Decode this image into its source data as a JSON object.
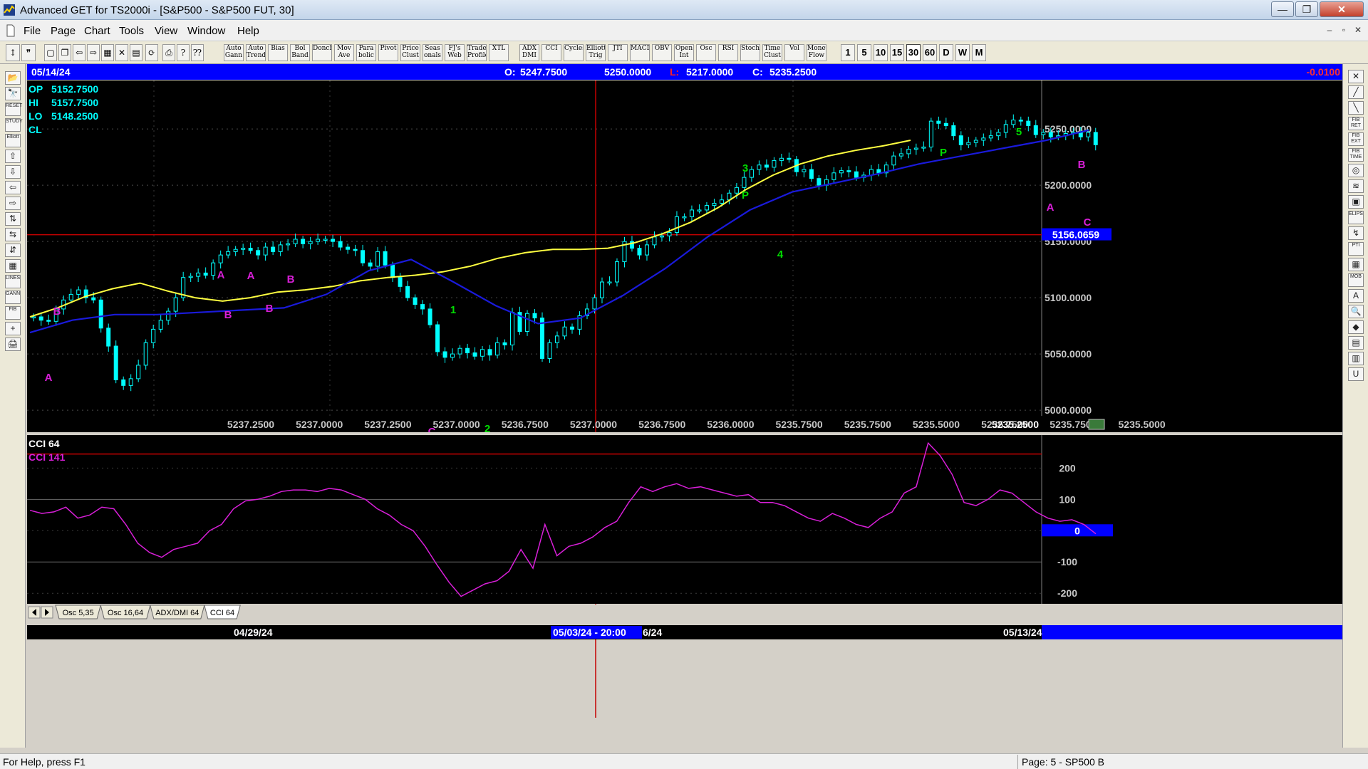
{
  "window": {
    "title": "Advanced GET for TS2000i - [S&P500 - S&P500 FUT, 30]",
    "min_glyph": "—",
    "max_glyph": "❐",
    "close_glyph": "✕"
  },
  "menu": {
    "items": [
      "File",
      "Page",
      "Chart",
      "Tools",
      "View",
      "Window",
      "Help"
    ],
    "mdi": [
      "–",
      "▫",
      "✕"
    ]
  },
  "toolbar": {
    "studies": [
      "Auto Gann",
      "Auto Trend",
      "Bias",
      "Bol Band",
      "Donch",
      "Mov Ave",
      "Para bolic",
      "Pivot",
      "Price Clust",
      "Seas onals",
      "FJ's Web",
      "Trade Profile",
      "XTL",
      "ADX DMI",
      "CCI",
      "Cycles",
      "Elliott Trig",
      "JTI",
      "MACD",
      "OBV",
      "Open Int",
      "Osc",
      "RSI",
      "Stoch",
      "Time Clust",
      "Vol",
      "Money Flow"
    ],
    "timeframes": [
      "1",
      "5",
      "10",
      "15",
      "30",
      "60",
      "D",
      "W",
      "M"
    ],
    "active_timeframe": "30"
  },
  "left_tools": [
    "📂",
    "🔭",
    "RESET",
    "STUDY",
    "Elliott",
    "⇧",
    "⇩",
    "⇦",
    "⇨",
    "⇅",
    "⇆",
    "⇵",
    "▦",
    "LINES",
    "GANN",
    "FIB",
    "+",
    "🖨"
  ],
  "right_tools": [
    "✕",
    "╱",
    "╲",
    "FIB RET",
    "FIB EXT",
    "FIB TIME",
    "◎",
    "≋",
    "▣",
    "ELIPS",
    "↯",
    "PTI",
    "▦",
    "MOB",
    "A",
    "🔍",
    "◆",
    "▤",
    "▥",
    "U"
  ],
  "infobar": {
    "date": "05/14/24",
    "open_label": "O:",
    "open": "5247.7500",
    "high": "5250.0000",
    "low_label": "L:",
    "low": "5217.0000",
    "close_label": "C:",
    "close": "5235.2500",
    "change": "-0.0100"
  },
  "ohlc_panel": [
    {
      "label": "OP",
      "value": "5152.7500"
    },
    {
      "label": "HI",
      "value": "5157.7500"
    },
    {
      "label": "LO",
      "value": "5148.2500"
    },
    {
      "label": "CL",
      "value": ""
    }
  ],
  "price_axis": {
    "ticks": [
      "5250.0000",
      "5200.0000",
      "5150.0000",
      "5100.0000",
      "5050.0000",
      "5000.0000"
    ],
    "tick_values": [
      5250,
      5200,
      5150,
      5100,
      5050,
      5000
    ],
    "cursor_price": "5156.0659",
    "cursor_value": 5156.0659,
    "range": [
      4995,
      5290
    ]
  },
  "bottom_values": [
    "5237.2500",
    "5237.0000",
    "5237.2500",
    "5237.0000",
    "5236.7500",
    "5237.0000",
    "5236.7500",
    "5236.0000",
    "5235.7500",
    "5235.7500",
    "5235.5000",
    "5235.7500",
    "5235.7500",
    "5235.5000"
  ],
  "last_value": "5235.2500",
  "cci": {
    "labels": [
      "CCI 64",
      "CCI  141"
    ],
    "ticks": [
      "200",
      "100",
      "-100",
      "-200"
    ],
    "tick_values": [
      200,
      100,
      -100,
      -200
    ],
    "zero_label": "0",
    "range": [
      -220,
      285
    ],
    "upper_line": 245
  },
  "tabs": [
    "Osc 5,35",
    "Osc 16,64",
    "ADX/DMI 64",
    "CCI 64"
  ],
  "active_tab": "CCI 64",
  "date_bar": {
    "dates": [
      "04/29/24",
      "05/13/24"
    ],
    "cursor_date": "05/03/24 - 20:00",
    "partial_date": "6/24"
  },
  "statusbar": {
    "help": "For Help, press F1",
    "page": "Page: 5 - SP500 B"
  },
  "colors": {
    "background": "#000000",
    "price_up": "#00ffff",
    "ma_fast": "#ffff40",
    "ma_slow": "#1a1adb",
    "cci": "#d81fd8",
    "elliott_green": "#00dd00",
    "elliott_magenta": "#d81fd8",
    "infobar": "#0000ff",
    "crosshair": "#c40000"
  },
  "chart_data": {
    "type": "candlestick",
    "price_series": [
      5083,
      5080,
      5079,
      5090,
      5098,
      5103,
      5107,
      5100,
      5098,
      5073,
      5057,
      5027,
      5022,
      5028,
      5040,
      5060,
      5072,
      5080,
      5088,
      5100,
      5118,
      5119,
      5122,
      5120,
      5131,
      5138,
      5141,
      5143,
      5144,
      5142,
      5138,
      5145,
      5141,
      5147,
      5148,
      5152,
      5148,
      5150,
      5152,
      5152,
      5150,
      5145,
      5143,
      5142,
      5131,
      5128,
      5141,
      5129,
      5118,
      5110,
      5100,
      5094,
      5090,
      5076,
      5052,
      5047,
      5050,
      5055,
      5051,
      5048,
      5054,
      5049,
      5060,
      5058,
      5087,
      5070,
      5086,
      5082,
      5046,
      5060,
      5066,
      5074,
      5072,
      5084,
      5090,
      5100,
      5114,
      5114,
      5132,
      5150,
      5144,
      5138,
      5147,
      5154,
      5155,
      5158,
      5172,
      5172,
      5178,
      5178,
      5182,
      5184,
      5187,
      5193,
      5198,
      5207,
      5214,
      5218,
      5216,
      5222,
      5224,
      5223,
      5212,
      5214,
      5206,
      5200,
      5205,
      5211,
      5213,
      5212,
      5207,
      5209,
      5214,
      5211,
      5218,
      5226,
      5228,
      5232,
      5233,
      5234,
      5257,
      5255,
      5253,
      5244,
      5236,
      5238,
      5240,
      5242,
      5244,
      5247,
      5254,
      5258,
      5257,
      5253,
      5245,
      5247,
      5243,
      5244,
      5246,
      5247,
      5243,
      5247,
      5236
    ],
    "ma_fast_series": [
      5083,
      5091,
      5101,
      5108,
      5113,
      5106,
      5100,
      5097,
      5100,
      5105,
      5107,
      5110,
      5115,
      5118,
      5120,
      5123,
      5128,
      5135,
      5140,
      5143,
      5143,
      5144,
      5149,
      5157,
      5167,
      5180,
      5196,
      5209,
      5219,
      5226,
      5231,
      5235,
      5240
    ],
    "ma_slow_series": [
      5069,
      5080,
      5085,
      5085,
      5087,
      5089,
      5091,
      5103,
      5124,
      5134,
      5114,
      5093,
      5077,
      5082,
      5102,
      5126,
      5154,
      5178,
      5194,
      5202,
      5210,
      5219,
      5226,
      5233,
      5240,
      5249
    ],
    "elliott_labels": [
      {
        "text": "A",
        "color": "magenta"
      },
      {
        "text": "B",
        "color": "magenta"
      },
      {
        "text": "P",
        "color": "green"
      },
      {
        "text": "C",
        "color": "magenta"
      },
      {
        "text": "B",
        "color": "magenta"
      },
      {
        "text": "A",
        "color": "magenta"
      },
      {
        "text": "B",
        "color": "magenta"
      },
      {
        "text": "A",
        "color": "magenta"
      },
      {
        "text": "B",
        "color": "magenta"
      },
      {
        "text": "1",
        "color": "green"
      },
      {
        "text": "C",
        "color": "magenta"
      },
      {
        "text": "2",
        "color": "green"
      },
      {
        "text": "3",
        "color": "green"
      },
      {
        "text": "P",
        "color": "green"
      },
      {
        "text": "4",
        "color": "green"
      },
      {
        "text": "5",
        "color": "green"
      },
      {
        "text": "P",
        "color": "green"
      },
      {
        "text": "B",
        "color": "magenta"
      },
      {
        "text": "A",
        "color": "magenta"
      },
      {
        "text": "C",
        "color": "magenta"
      }
    ],
    "cci_series": [
      65,
      55,
      60,
      75,
      40,
      50,
      75,
      70,
      20,
      -40,
      -70,
      -85,
      -60,
      -50,
      -40,
      0,
      20,
      70,
      95,
      100,
      110,
      125,
      130,
      130,
      125,
      135,
      130,
      115,
      100,
      70,
      50,
      20,
      0,
      -50,
      -110,
      -165,
      -210,
      -190,
      -170,
      -160,
      -130,
      -60,
      -120,
      20,
      -80,
      -50,
      -40,
      -20,
      10,
      30,
      90,
      140,
      125,
      140,
      150,
      135,
      140,
      130,
      120,
      110,
      115,
      90,
      90,
      80,
      60,
      40,
      30,
      55,
      40,
      20,
      10,
      40,
      60,
      120,
      140,
      280,
      240,
      180,
      90,
      80,
      100,
      130,
      120,
      90,
      60,
      40,
      30,
      35,
      20,
      -10
    ]
  }
}
